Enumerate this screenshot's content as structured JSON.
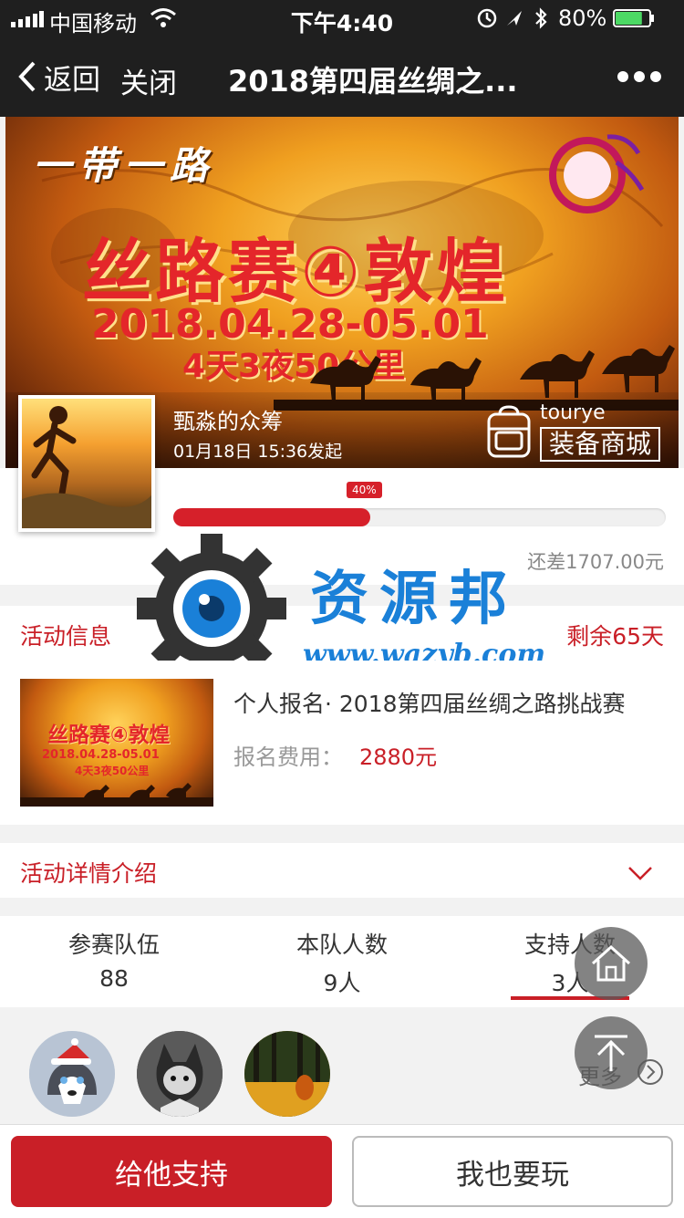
{
  "status_bar": {
    "carrier": "中国移动",
    "time": "下午4:40",
    "battery": "80%",
    "battery_level": 0.8
  },
  "nav": {
    "back_label": "返回",
    "close_label": "关闭",
    "title": "2018第四届丝绸之..."
  },
  "banner": {
    "slogan": "一带一路",
    "headline": "丝路赛④敦煌",
    "dates": "2018.04.28-05.01",
    "subtitle": "4天3夜50公里"
  },
  "crowdfund": {
    "organizer": "甄淼的众筹",
    "launched": "01月18日 15:36发起",
    "shop_brand": "tourye",
    "shop_label": "装备商城",
    "progress_label": "40%",
    "progress_value": 0.4,
    "remaining_amount": "还差1707.00元"
  },
  "watermark": {
    "name": "资源邦",
    "url": "www.wazyb.com"
  },
  "activity": {
    "header": "活动信息",
    "days_left": "剩余65天",
    "thumb_headline": "丝路赛④敦煌",
    "thumb_dates": "2018.04.28-05.01",
    "thumb_sub": "4天3夜50公里",
    "title": "个人报名· 2018第四届丝绸之路挑战赛",
    "fee_label": "报名费用：",
    "fee_value": "2880元"
  },
  "details": {
    "header": "活动详情介绍"
  },
  "stats": [
    {
      "label": "参赛队伍",
      "value": "88"
    },
    {
      "label": "本队人数",
      "value": "9人"
    },
    {
      "label": "支持人数",
      "value": "3人"
    }
  ],
  "supporters": {
    "more_label": "更多"
  },
  "footer": {
    "support_button": "给他支持",
    "join_button": "我也要玩"
  },
  "colors": {
    "accent": "#c91f27",
    "nav_bg": "#1f1f1f",
    "watermark": "#1a80d8"
  }
}
